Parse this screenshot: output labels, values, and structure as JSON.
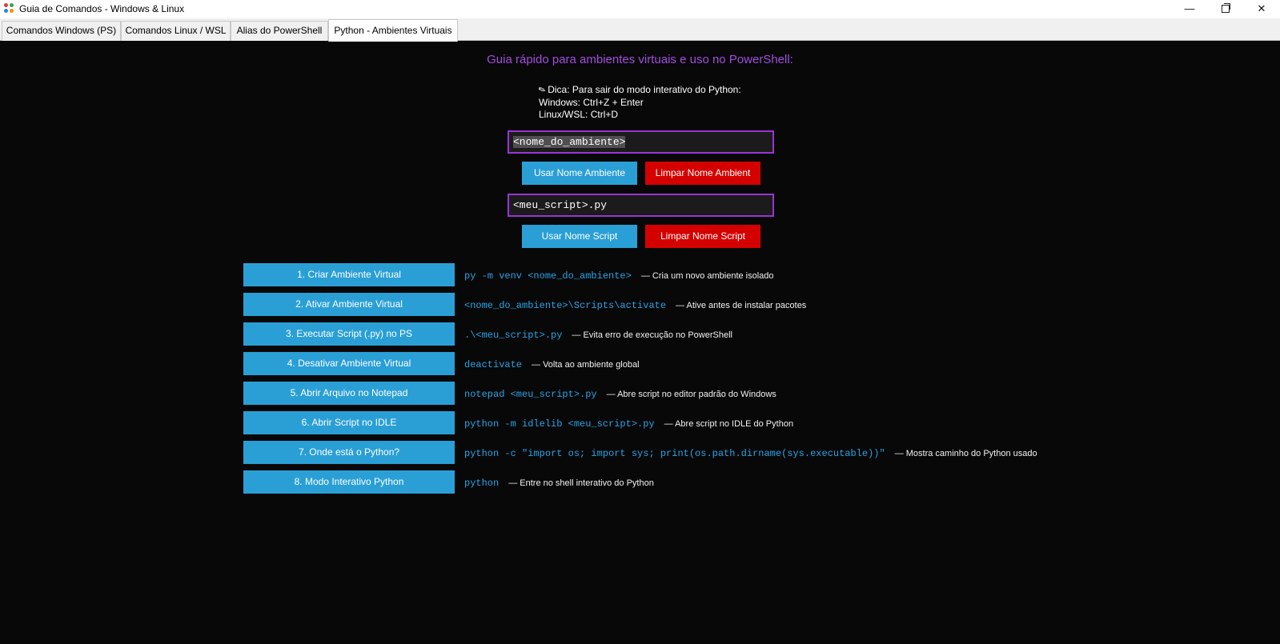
{
  "window": {
    "title": "Guia de Comandos - Windows & Linux",
    "min_glyph": "—",
    "close_glyph": "✕"
  },
  "tabs": [
    {
      "label": "Comandos Windows (PS)"
    },
    {
      "label": "Comandos Linux / WSL"
    },
    {
      "label": "Alias do PowerShell"
    },
    {
      "label": "Python - Ambientes Virtuais",
      "active": true
    }
  ],
  "heading": "Guia rápido para ambientes virtuais e uso no PowerShell:",
  "tip": {
    "icon": "pencil-icon",
    "line1": "Dica: Para sair do modo interativo do Python:",
    "line2": "Windows: Ctrl+Z + Enter",
    "line3": "Linux/WSL: Ctrl+D"
  },
  "env_input": {
    "value": "<nome_do_ambiente>"
  },
  "env_buttons": {
    "use": "Usar Nome Ambiente",
    "clear": "Limpar Nome Ambient"
  },
  "script_input": {
    "value": "<meu_script>.py"
  },
  "script_buttons": {
    "use": "Usar Nome Script",
    "clear": "Limpar Nome Script"
  },
  "commands": [
    {
      "label": "1. Criar Ambiente Virtual",
      "code": "py -m venv <nome_do_ambiente>",
      "desc": "— Cria um novo ambiente isolado"
    },
    {
      "label": "2. Ativar Ambiente Virtual",
      "code": "<nome_do_ambiente>\\Scripts\\activate",
      "desc": "— Ative antes de instalar pacotes"
    },
    {
      "label": "3. Executar Script (.py) no PS",
      "code": ".\\<meu_script>.py",
      "desc": "— Evita erro de execução no PowerShell"
    },
    {
      "label": "4. Desativar Ambiente Virtual",
      "code": "deactivate",
      "desc": "— Volta ao ambiente global"
    },
    {
      "label": "5. Abrir Arquivo no Notepad",
      "code": "notepad <meu_script>.py",
      "desc": "— Abre script no editor padrão do Windows"
    },
    {
      "label": "6. Abrir Script no IDLE",
      "code": "python -m idlelib <meu_script>.py",
      "desc": "— Abre script no IDLE do Python"
    },
    {
      "label": "7. Onde está o Python?",
      "code": "python -c \"import os; import sys; print(os.path.dirname(sys.executable))\"",
      "desc": "— Mostra caminho do Python usado"
    },
    {
      "label": "8. Modo Interativo Python",
      "code": "python",
      "desc": "— Entre no shell interativo do Python"
    }
  ],
  "colors": {
    "heading": "#a24de2",
    "button_blue": "#2a9fd6",
    "button_red": "#d40000",
    "code": "#27a4e8",
    "input_border": "#9b33d6"
  }
}
